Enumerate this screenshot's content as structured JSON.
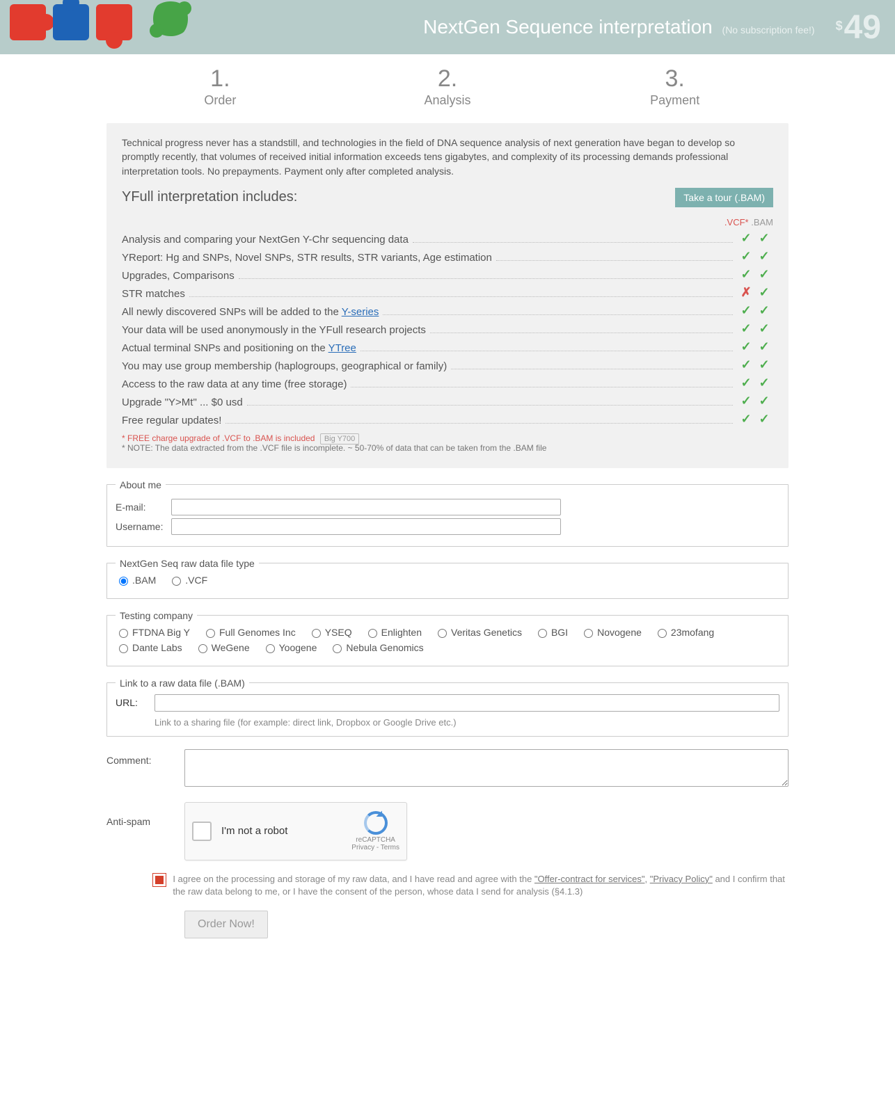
{
  "header": {
    "title": "NextGen Sequence interpretation",
    "subtitle": "(No subscription fee!)",
    "price": "49",
    "currency": "$"
  },
  "steps": [
    {
      "num": "1.",
      "label": "Order"
    },
    {
      "num": "2.",
      "label": "Analysis"
    },
    {
      "num": "3.",
      "label": "Payment"
    }
  ],
  "intro": "Technical progress never has a standstill, and technologies in the field of DNA sequence analysis of next generation have began to develop so promptly recently, that volumes of received initial information exceeds tens gigabytes, and complexity of its processing demands professional interpretation tools. No prepayments. Payment only after completed analysis.",
  "includes_title": "YFull interpretation includes:",
  "tour_button": "Take a tour (.BAM)",
  "columns": {
    "vcf": ".VCF*",
    "bam": ".BAM"
  },
  "features": [
    {
      "text": "Analysis and comparing your NextGen Y-Chr sequencing data",
      "vcf": true,
      "bam": true
    },
    {
      "text": "YReport: Hg and SNPs, Novel SNPs, STR results, STR variants, Age estimation",
      "vcf": true,
      "bam": true
    },
    {
      "text": "Upgrades, Comparisons",
      "vcf": true,
      "bam": true
    },
    {
      "text": "STR matches",
      "vcf": false,
      "bam": true
    },
    {
      "text": "All newly discovered SNPs will be added to the ",
      "link": "Y-series",
      "vcf": true,
      "bam": true
    },
    {
      "text": "Your data will be used anonymously in the YFull research projects",
      "vcf": true,
      "bam": true
    },
    {
      "text": "Actual terminal SNPs and positioning on the ",
      "link": "YTree",
      "vcf": true,
      "bam": true
    },
    {
      "text": "You may use group membership (haplogroups, geographical or family)",
      "vcf": true,
      "bam": true
    },
    {
      "text": "Access to the raw data at any time (free storage)",
      "vcf": true,
      "bam": true
    },
    {
      "text": "Upgrade \"Y>Mt\" ... $0 usd",
      "vcf": true,
      "bam": true
    },
    {
      "text": "Free regular updates!",
      "vcf": true,
      "bam": true
    }
  ],
  "footnote": {
    "free": "* FREE charge upgrade of .VCF to .BAM is included",
    "tag": "Big Y700",
    "note": "* NOTE: The data extracted from the .VCF file is incomplete. ~ 50-70% of data that can be taken from the .BAM file"
  },
  "form": {
    "about_legend": "About me",
    "email_label": "E-mail:",
    "username_label": "Username:",
    "filetype_legend": "NextGen Seq raw data file type",
    "filetype_options": [
      ".BAM",
      ".VCF"
    ],
    "filetype_selected": ".BAM",
    "company_legend": "Testing company",
    "companies": [
      "FTDNA Big Y",
      "Full Genomes Inc",
      "YSEQ",
      "Enlighten",
      "Veritas Genetics",
      "BGI",
      "Novogene",
      "23mofang",
      "Dante Labs",
      "WeGene",
      "Yoogene",
      "Nebula Genomics"
    ],
    "link_legend": "Link to a raw data file (.BAM)",
    "url_label": "URL:",
    "link_hint": "Link to a sharing file (for example: direct link, Dropbox or Google Drive etc.)",
    "comment_label": "Comment:",
    "antispam_label": "Anti-spam",
    "recaptcha": {
      "text": "I'm not a robot",
      "brand": "reCAPTCHA",
      "links": "Privacy - Terms"
    },
    "agree_text_1": "I agree on the processing and storage of my raw data, and I have read and agree with the ",
    "agree_link_1": "\"Offer-contract for services\"",
    "agree_sep": ", ",
    "agree_link_2": "\"Privacy Policy\"",
    "agree_text_2": " and I confirm that the raw data belong to me, or I have the consent of the person, whose data I send for analysis (§4.1.3)",
    "submit": "Order Now!"
  }
}
